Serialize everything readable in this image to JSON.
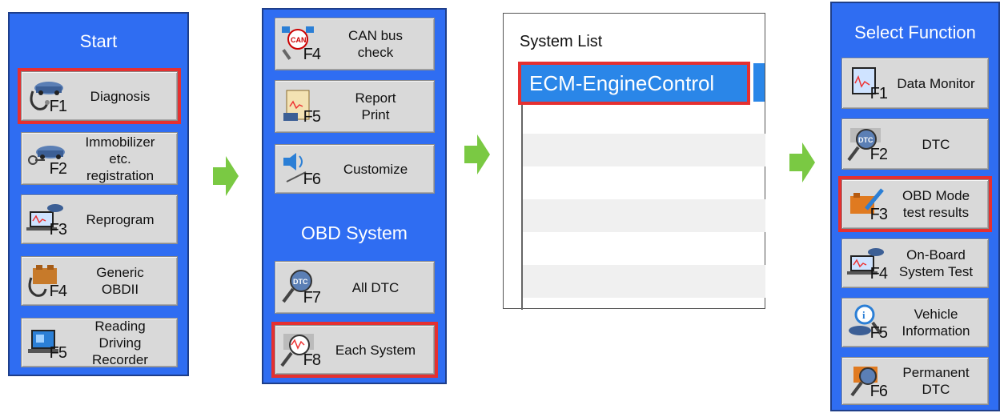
{
  "colors": {
    "panel_blue": "#2f6df2",
    "highlight_red": "#e53030",
    "arrow_green": "#7ac943",
    "selection_blue": "#2a86e8"
  },
  "start_panel": {
    "title": "Start",
    "buttons": [
      {
        "label": "Diagnosis",
        "fkey": "F1",
        "icon": "car-stethoscope-icon",
        "highlighted": true
      },
      {
        "label": "Immobilizer\netc.\nregistration",
        "fkey": "F2",
        "icon": "car-key-icon",
        "highlighted": false
      },
      {
        "label": "Reprogram",
        "fkey": "F3",
        "icon": "car-laptop-icon",
        "highlighted": false
      },
      {
        "label": "Generic\nOBDII",
        "fkey": "F4",
        "icon": "engine-stethoscope-icon",
        "highlighted": false
      },
      {
        "label": "Reading\nDriving\nRecorder",
        "fkey": "F5",
        "icon": "recorder-computer-icon",
        "highlighted": false
      }
    ]
  },
  "menu_panel": {
    "buttons_top": [
      {
        "label": "CAN bus\ncheck",
        "fkey": "F4",
        "icon": "can-network-icon",
        "highlighted": false
      },
      {
        "label": "Report\nPrint",
        "fkey": "F5",
        "icon": "report-scroll-icon",
        "highlighted": false
      },
      {
        "label": "Customize",
        "fkey": "F6",
        "icon": "speaker-icon",
        "highlighted": false
      }
    ],
    "obd_title": "OBD System",
    "buttons_obd": [
      {
        "label": "All DTC",
        "fkey": "F7",
        "icon": "dtc-magnifier-icon",
        "highlighted": false
      },
      {
        "label": "Each System",
        "fkey": "F8",
        "icon": "waveform-magnifier-icon",
        "highlighted": true
      }
    ]
  },
  "system_list": {
    "title": "System List",
    "selected": "ECM-EngineControl"
  },
  "function_panel": {
    "title": "Select Function",
    "buttons": [
      {
        "label": "Data Monitor",
        "fkey": "F1",
        "icon": "monitor-waveform-icon",
        "highlighted": false
      },
      {
        "label": "DTC",
        "fkey": "F2",
        "icon": "dtc-magnifier-icon",
        "highlighted": false
      },
      {
        "label": "OBD Mode\ntest results",
        "fkey": "F3",
        "icon": "engine-test-icon",
        "highlighted": true
      },
      {
        "label": "On-Board\nSystem Test",
        "fkey": "F4",
        "icon": "car-laptop-icon",
        "highlighted": false
      },
      {
        "label": "Vehicle\nInformation",
        "fkey": "F5",
        "icon": "vehicle-info-icon",
        "highlighted": false
      },
      {
        "label": "Permanent\nDTC",
        "fkey": "F6",
        "icon": "engine-magnifier-icon",
        "highlighted": false
      }
    ]
  }
}
